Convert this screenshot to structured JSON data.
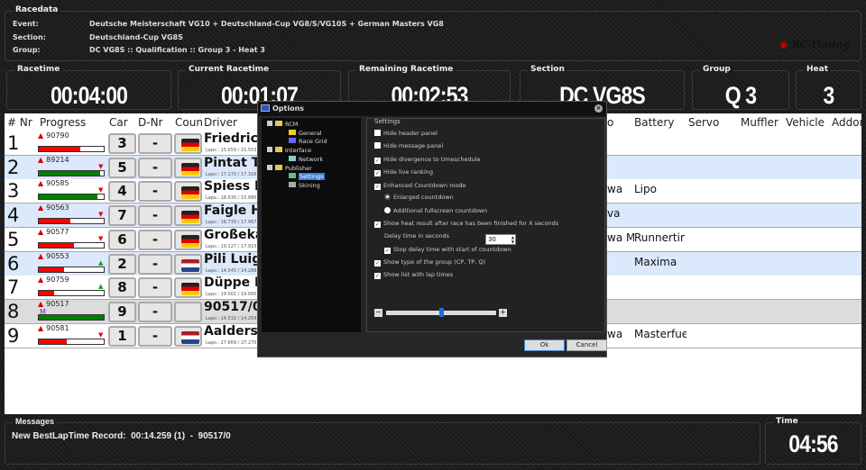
{
  "racedata": {
    "legend": "Racedata",
    "event_label": "Event:",
    "event": "Deutsche Meisterschaft VG10 + Deutschland-Cup VG8/S/VG10S + German Masters VG8",
    "section_label": "Section:",
    "section": "Deutschland-Cup VG8S",
    "group_label": "Group:",
    "group": "DC VG8S :: Qualification :: Group 3 - Heat 3",
    "logo": "RC-Timing"
  },
  "panels": [
    {
      "label": "Racetime",
      "value": "00:04:00"
    },
    {
      "label": "Current Racetime",
      "value": "00:01:07"
    },
    {
      "label": "Remaining Racetime",
      "value": "00:02:53"
    },
    {
      "label": "Section",
      "value": "DC VG8S"
    },
    {
      "label": "Group",
      "value": "Q 3"
    },
    {
      "label": "Heat",
      "value": "3"
    }
  ],
  "table": {
    "headers": {
      "nr": "# Nr",
      "progress": "Progress",
      "car": "Car",
      "dnr": "D-Nr",
      "country": "Coun",
      "driver": "Driver",
      "hidden": "o",
      "battery": "Battery",
      "servo": "Servo",
      "muffler": "Muffler",
      "vehicle": "Vehicle",
      "addon": "Addon"
    },
    "rows": [
      {
        "pos": "1",
        "id": "90790",
        "progress": 0.64,
        "bar": "red",
        "trend": "",
        "car": "3",
        "dnr": "-",
        "flag": "de",
        "driver": "Friedrich",
        "laps": "Laps:: 15.659 / 15.553",
        "hidden": "",
        "battery": ""
      },
      {
        "pos": "2",
        "id": "89214",
        "progress": 0.95,
        "bar": "green",
        "trend": "down",
        "car": "5",
        "dnr": "-",
        "flag": "de",
        "driver": "Pintat Th",
        "laps": "Laps:: 17.170 / 17.316",
        "hidden": "",
        "battery": ""
      },
      {
        "pos": "3",
        "id": "90585",
        "progress": 0.9,
        "bar": "green",
        "trend": "down",
        "car": "4",
        "dnr": "-",
        "flag": "de",
        "driver": "Spiess D",
        "laps": "Laps:: 18.630 / 15.880",
        "hidden": "wa",
        "battery": "Lipo"
      },
      {
        "pos": "4",
        "id": "90563",
        "progress": 0.48,
        "bar": "red",
        "trend": "down",
        "car": "7",
        "dnr": "-",
        "flag": "de",
        "driver": "Faigle He",
        "laps": "Laps:: 18.739 / 17.967",
        "hidden": "va",
        "battery": ""
      },
      {
        "pos": "5",
        "id": "90577",
        "progress": 0.54,
        "bar": "red",
        "trend": "down",
        "car": "6",
        "dnr": "-",
        "flag": "de",
        "driver": "Großekat",
        "laps": "Laps:: 19.127 / 17.915",
        "hidden": "wa M",
        "battery": "Runnertir"
      },
      {
        "pos": "6",
        "id": "90553",
        "progress": 0.39,
        "bar": "red",
        "trend": "up",
        "car": "2",
        "dnr": "-",
        "flag": "nl",
        "driver": "Pili Luigi",
        "laps": "Laps:: 14.545 / 14.288",
        "hidden": "",
        "battery": "Maxima"
      },
      {
        "pos": "7",
        "id": "90759",
        "progress": 0.23,
        "bar": "red",
        "trend": "up",
        "car": "8",
        "dnr": "-",
        "flag": "de",
        "driver": "Düppe Fl",
        "laps": "Laps:: 19.001 / 19.000",
        "hidden": "",
        "battery": ""
      },
      {
        "pos": "8",
        "id": "90517",
        "sub": "M",
        "progress": 1.0,
        "bar": "green",
        "trend": "",
        "car": "9",
        "dnr": "-",
        "flag": "",
        "driver": "90517/0",
        "laps": "Laps:: 14.532 / 14.259",
        "hidden": "",
        "battery": ""
      },
      {
        "pos": "9",
        "id": "90581",
        "progress": 0.43,
        "bar": "red",
        "trend": "down",
        "car": "1",
        "dnr": "-",
        "flag": "nl",
        "driver": "Aalders I",
        "laps": "Laps:: 27.669 / 27.275",
        "hidden": "wa",
        "battery": "Masterfue"
      }
    ]
  },
  "dialog": {
    "title": "Options",
    "tree": [
      {
        "label": "RCM",
        "level": 0,
        "icon": "folder"
      },
      {
        "label": "General",
        "level": 1,
        "icon": "gear"
      },
      {
        "label": "Race Grid",
        "level": 1,
        "icon": "grid"
      },
      {
        "label": "Interface",
        "level": 0,
        "icon": "folder"
      },
      {
        "label": "Network",
        "level": 1,
        "icon": "network"
      },
      {
        "label": "Publisher",
        "level": 0,
        "icon": "folder"
      },
      {
        "label": "Settings",
        "level": 1,
        "icon": "settings",
        "selected": true
      },
      {
        "label": "Skining",
        "level": 1,
        "icon": "skin"
      }
    ],
    "settings_legend": "Settings",
    "options": [
      {
        "label": "Hide header panel",
        "type": "check",
        "checked": false,
        "indent": 0
      },
      {
        "label": "Hide message panel",
        "type": "check",
        "checked": false,
        "indent": 0
      },
      {
        "label": "Hide divergence to timeschedule",
        "type": "check",
        "checked": true,
        "indent": 0
      },
      {
        "label": "Hide live ranking",
        "type": "check",
        "checked": true,
        "indent": 0
      },
      {
        "label": "Enhanced Countdown mode",
        "type": "check",
        "checked": true,
        "indent": 0
      },
      {
        "label": "Enlarged countdown",
        "type": "radio",
        "checked": true,
        "indent": 1
      },
      {
        "label": "Additional fullscreen countdown",
        "type": "radio",
        "checked": false,
        "indent": 1
      },
      {
        "label": "Show heat result after race has been finished for X seconds",
        "type": "check",
        "checked": true,
        "indent": 0
      },
      {
        "label": "Delay time in seconds",
        "type": "label",
        "indent": 1
      },
      {
        "label": "Stop delay time with start of countdown",
        "type": "check",
        "checked": true,
        "indent": 1
      },
      {
        "label": "Show type of the group (CP, TP, Q)",
        "type": "check",
        "checked": true,
        "indent": 0
      },
      {
        "label": "Show list with lap times",
        "type": "check",
        "checked": true,
        "indent": 0
      }
    ],
    "delay_value": "30",
    "slider_value": 0.5,
    "ok": "Ok",
    "cancel": "Cancel"
  },
  "messages": {
    "legend": "Messages",
    "text": "New BestLapTime Record:  00:14.259 (1)  -  90517/0"
  },
  "time": {
    "legend": "Time",
    "value": "04:56"
  },
  "colors": {
    "row_alt": "#dce8fb",
    "row_highlight": "#dcdcdc",
    "bar_red": "#ff0000",
    "bar_green": "#008000",
    "selection": "#3b7fd6"
  }
}
